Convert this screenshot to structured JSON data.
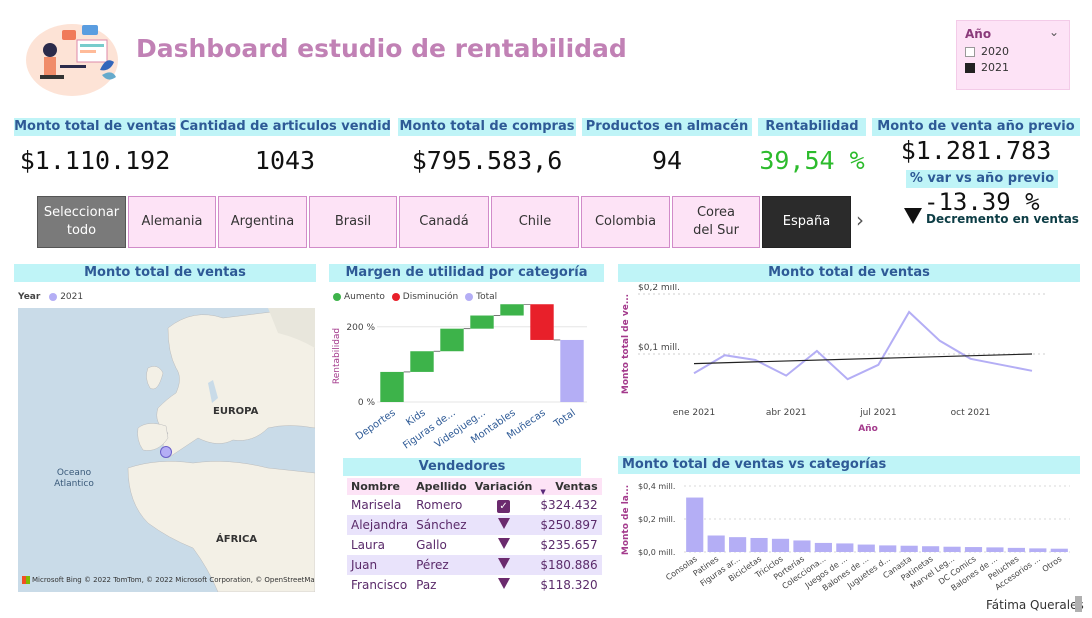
{
  "header": {
    "title": "Dashboard estudio de rentabilidad"
  },
  "year_slicer": {
    "title": "Año",
    "options": [
      {
        "label": "2020",
        "checked": false
      },
      {
        "label": "2021",
        "checked": true
      }
    ]
  },
  "kpis": [
    {
      "label": "Monto total de ventas",
      "value": "$1.110.192"
    },
    {
      "label": "Cantidad de articulos vendidos",
      "value": "1043"
    },
    {
      "label": "Monto total de compras",
      "value": "$795.583,6"
    },
    {
      "label": "Productos en almacén",
      "value": "94"
    },
    {
      "label": "Rentabilidad",
      "value": "39,54 %"
    },
    {
      "label": "Monto de venta año previo",
      "value": "$1.281.783"
    }
  ],
  "var_kpi": {
    "label": "% var vs año previo",
    "value": "-13.39 %",
    "note": "Decremento en ventas"
  },
  "country_slicer": {
    "items": [
      "Seleccionar todo",
      "Alemania",
      "Argentina",
      "Brasil",
      "Canadá",
      "Chile",
      "Colombia",
      "Corea del Sur",
      "España"
    ],
    "next": "›"
  },
  "map_panel": {
    "title": "Monto total de ventas",
    "legend_label": "Year",
    "legend_item": "2021",
    "labels": {
      "europe": "EUROPA",
      "ocean": "Oceano Atlantico",
      "africa": "ÁFRICA"
    },
    "attribution_brand": "Microsoft Bing",
    "attribution": "© 2022 TomTom, © 2022 Microsoft Corporation, © OpenStreetMap"
  },
  "waterfall": {
    "title": "Margen de utilidad por categoría",
    "legend": [
      "Aumento",
      "Disminución",
      "Total"
    ],
    "colors": {
      "increase": "#3db34a",
      "decrease": "#e8202a",
      "total": "#b4aef5"
    },
    "ylabel": "Rentabilidad",
    "yticks": [
      "0 %",
      "200 %"
    ],
    "categories": [
      "Deportes",
      "Kids",
      "Figuras de...",
      "Videojueg...",
      "Montables",
      "Muñecas",
      "Total"
    ]
  },
  "vendedores": {
    "title": "Vendedores",
    "columns": [
      "Nombre",
      "Apellido",
      "Variación",
      "Ventas"
    ],
    "rows": [
      {
        "nombre": "Marisela",
        "apellido": "Romero",
        "variacion": "up",
        "ventas": "$324.432"
      },
      {
        "nombre": "Alejandra",
        "apellido": "Sánchez",
        "variacion": "down",
        "ventas": "$250.897"
      },
      {
        "nombre": "Laura",
        "apellido": "Gallo",
        "variacion": "down",
        "ventas": "$235.657"
      },
      {
        "nombre": "Juan",
        "apellido": "Pérez",
        "variacion": "down",
        "ventas": "$180.886"
      },
      {
        "nombre": "Francisco",
        "apellido": "Paz",
        "variacion": "down",
        "ventas": "$118.320"
      }
    ]
  },
  "line_panel": {
    "title": "Monto total de ventas"
  },
  "bar_panel": {
    "title": "Monto total de ventas vs categorías"
  },
  "footer": {
    "author": "Fátima Querales"
  },
  "chart_data": [
    {
      "type": "bar",
      "chart": "waterfall",
      "title": "Margen de utilidad por categoría",
      "ylabel": "Rentabilidad",
      "categories": [
        "Deportes",
        "Kids",
        "Figuras de...",
        "Videojueg...",
        "Montables",
        "Muñecas",
        "Total"
      ],
      "values": [
        80,
        55,
        60,
        35,
        30,
        -95,
        165
      ],
      "ylim": [
        0,
        250
      ]
    },
    {
      "type": "line",
      "chart": "line",
      "title": "Monto total de ventas",
      "xlabel": "Año",
      "ylabel": "Monto total de ve...",
      "x": [
        "2021-01",
        "2021-02",
        "2021-03",
        "2021-04",
        "2021-05",
        "2021-06",
        "2021-07",
        "2021-08",
        "2021-09",
        "2021-10",
        "2021-11",
        "2021-12"
      ],
      "xticks": [
        "ene 2021",
        "abr 2021",
        "jul 2021",
        "oct 2021"
      ],
      "yticks": [
        "$0,1 mill.",
        "$0,2 mill."
      ],
      "series": [
        {
          "values": [
            0.068,
            0.098,
            0.09,
            0.064,
            0.105,
            0.058,
            0.082,
            0.17,
            0.122,
            0.092,
            0.082,
            0.072
          ]
        }
      ],
      "trend": [
        0.084,
        0.1
      ],
      "ylim": [
        0.03,
        0.2
      ]
    },
    {
      "type": "bar",
      "chart": "bar",
      "title": "Monto total de ventas vs categorías",
      "ylabel": "Monto de la...",
      "categories": [
        "Consolas",
        "Patines",
        "Figuras ar...",
        "Bicicletas",
        "Triciclos",
        "Porterías",
        "Colecciona...",
        "Juegos de ...",
        "Balones de ...",
        "Juguetes d...",
        "Canasta",
        "Patinetas",
        "Marvel Leg...",
        "DC Comics",
        "Balones de ...",
        "Peluches",
        "Accesorios ...",
        "Otros"
      ],
      "values": [
        0.33,
        0.1,
        0.09,
        0.085,
        0.08,
        0.07,
        0.055,
        0.052,
        0.045,
        0.04,
        0.038,
        0.035,
        0.032,
        0.03,
        0.028,
        0.025,
        0.022,
        0.02
      ],
      "yticks": [
        "$0,0 mill.",
        "$0,2 mill.",
        "$0,4 mill."
      ],
      "ylim": [
        0,
        0.4
      ]
    }
  ]
}
